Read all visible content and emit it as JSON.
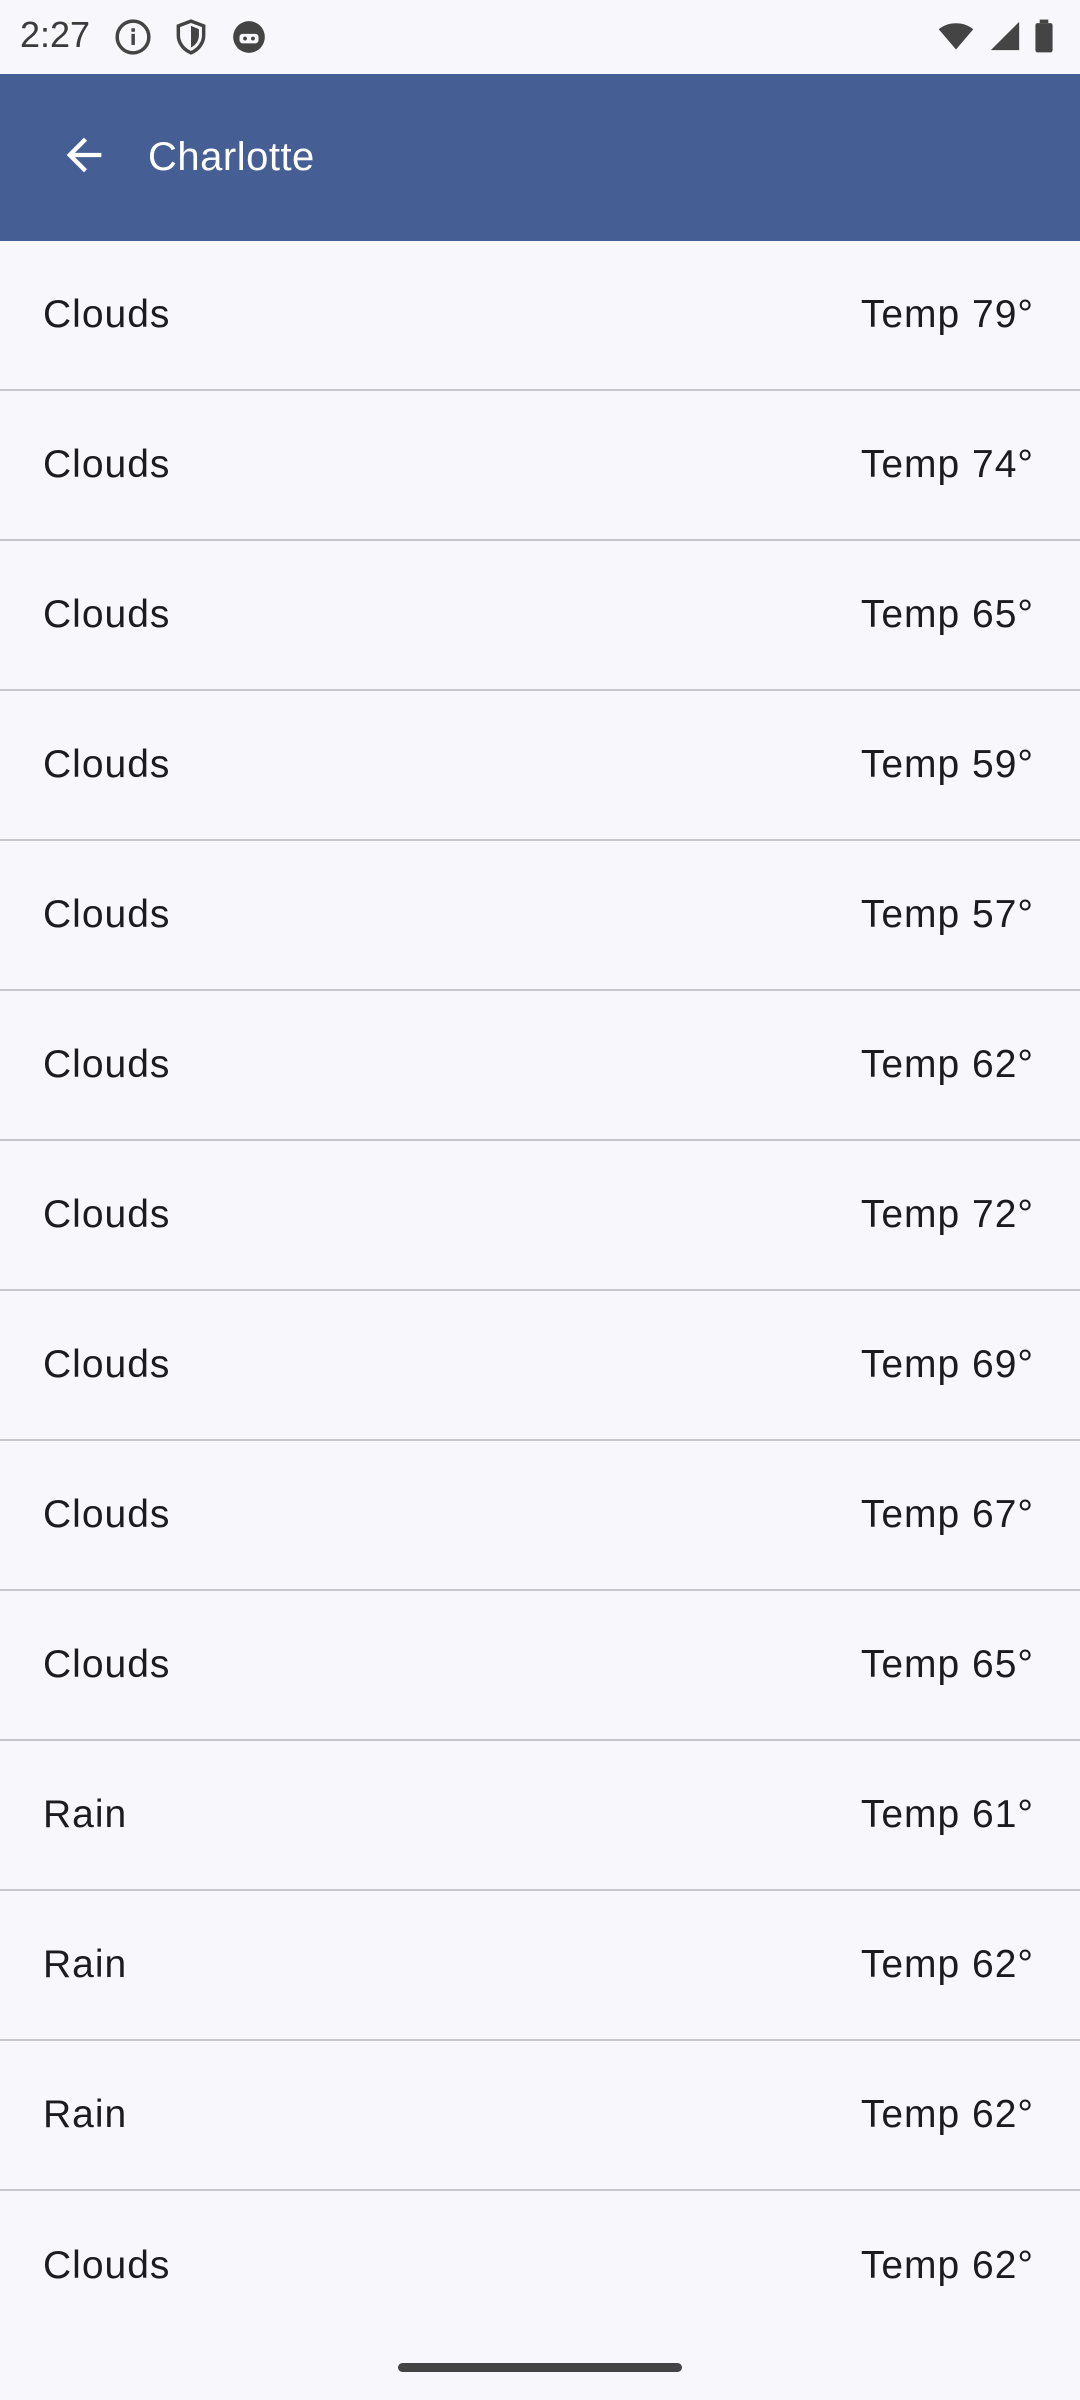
{
  "status_bar": {
    "time": "2:27",
    "left_icons": [
      "info-icon",
      "shield-icon",
      "android-icon"
    ],
    "right_icons": [
      "wifi-icon",
      "cell-signal-icon",
      "battery-icon"
    ]
  },
  "app_bar": {
    "title": "Charlotte",
    "back_icon": "arrow-back-icon",
    "color": "#455E93"
  },
  "forecast": [
    {
      "condition": "Clouds",
      "temp": "Temp 79°"
    },
    {
      "condition": "Clouds",
      "temp": "Temp 74°"
    },
    {
      "condition": "Clouds",
      "temp": "Temp 65°"
    },
    {
      "condition": "Clouds",
      "temp": "Temp 59°"
    },
    {
      "condition": "Clouds",
      "temp": "Temp 57°"
    },
    {
      "condition": "Clouds",
      "temp": "Temp 62°"
    },
    {
      "condition": "Clouds",
      "temp": "Temp 72°"
    },
    {
      "condition": "Clouds",
      "temp": "Temp 69°"
    },
    {
      "condition": "Clouds",
      "temp": "Temp 67°"
    },
    {
      "condition": "Clouds",
      "temp": "Temp 65°"
    },
    {
      "condition": "Rain",
      "temp": "Temp 61°"
    },
    {
      "condition": "Rain",
      "temp": "Temp 62°"
    },
    {
      "condition": "Rain",
      "temp": "Temp 62°"
    },
    {
      "condition": "Clouds",
      "temp": "Temp 62°"
    }
  ]
}
